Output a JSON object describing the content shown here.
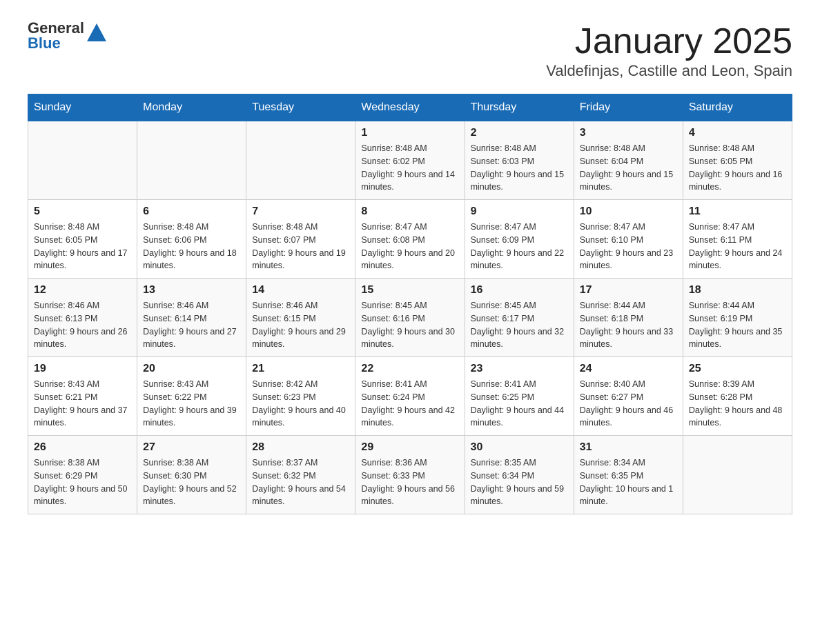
{
  "header": {
    "logo": {
      "general": "General",
      "blue": "Blue"
    },
    "title": "January 2025",
    "subtitle": "Valdefinjas, Castille and Leon, Spain"
  },
  "calendar": {
    "days_of_week": [
      "Sunday",
      "Monday",
      "Tuesday",
      "Wednesday",
      "Thursday",
      "Friday",
      "Saturday"
    ],
    "weeks": [
      [
        {
          "day": "",
          "info": ""
        },
        {
          "day": "",
          "info": ""
        },
        {
          "day": "",
          "info": ""
        },
        {
          "day": "1",
          "info": "Sunrise: 8:48 AM\nSunset: 6:02 PM\nDaylight: 9 hours and 14 minutes."
        },
        {
          "day": "2",
          "info": "Sunrise: 8:48 AM\nSunset: 6:03 PM\nDaylight: 9 hours and 15 minutes."
        },
        {
          "day": "3",
          "info": "Sunrise: 8:48 AM\nSunset: 6:04 PM\nDaylight: 9 hours and 15 minutes."
        },
        {
          "day": "4",
          "info": "Sunrise: 8:48 AM\nSunset: 6:05 PM\nDaylight: 9 hours and 16 minutes."
        }
      ],
      [
        {
          "day": "5",
          "info": "Sunrise: 8:48 AM\nSunset: 6:05 PM\nDaylight: 9 hours and 17 minutes."
        },
        {
          "day": "6",
          "info": "Sunrise: 8:48 AM\nSunset: 6:06 PM\nDaylight: 9 hours and 18 minutes."
        },
        {
          "day": "7",
          "info": "Sunrise: 8:48 AM\nSunset: 6:07 PM\nDaylight: 9 hours and 19 minutes."
        },
        {
          "day": "8",
          "info": "Sunrise: 8:47 AM\nSunset: 6:08 PM\nDaylight: 9 hours and 20 minutes."
        },
        {
          "day": "9",
          "info": "Sunrise: 8:47 AM\nSunset: 6:09 PM\nDaylight: 9 hours and 22 minutes."
        },
        {
          "day": "10",
          "info": "Sunrise: 8:47 AM\nSunset: 6:10 PM\nDaylight: 9 hours and 23 minutes."
        },
        {
          "day": "11",
          "info": "Sunrise: 8:47 AM\nSunset: 6:11 PM\nDaylight: 9 hours and 24 minutes."
        }
      ],
      [
        {
          "day": "12",
          "info": "Sunrise: 8:46 AM\nSunset: 6:13 PM\nDaylight: 9 hours and 26 minutes."
        },
        {
          "day": "13",
          "info": "Sunrise: 8:46 AM\nSunset: 6:14 PM\nDaylight: 9 hours and 27 minutes."
        },
        {
          "day": "14",
          "info": "Sunrise: 8:46 AM\nSunset: 6:15 PM\nDaylight: 9 hours and 29 minutes."
        },
        {
          "day": "15",
          "info": "Sunrise: 8:45 AM\nSunset: 6:16 PM\nDaylight: 9 hours and 30 minutes."
        },
        {
          "day": "16",
          "info": "Sunrise: 8:45 AM\nSunset: 6:17 PM\nDaylight: 9 hours and 32 minutes."
        },
        {
          "day": "17",
          "info": "Sunrise: 8:44 AM\nSunset: 6:18 PM\nDaylight: 9 hours and 33 minutes."
        },
        {
          "day": "18",
          "info": "Sunrise: 8:44 AM\nSunset: 6:19 PM\nDaylight: 9 hours and 35 minutes."
        }
      ],
      [
        {
          "day": "19",
          "info": "Sunrise: 8:43 AM\nSunset: 6:21 PM\nDaylight: 9 hours and 37 minutes."
        },
        {
          "day": "20",
          "info": "Sunrise: 8:43 AM\nSunset: 6:22 PM\nDaylight: 9 hours and 39 minutes."
        },
        {
          "day": "21",
          "info": "Sunrise: 8:42 AM\nSunset: 6:23 PM\nDaylight: 9 hours and 40 minutes."
        },
        {
          "day": "22",
          "info": "Sunrise: 8:41 AM\nSunset: 6:24 PM\nDaylight: 9 hours and 42 minutes."
        },
        {
          "day": "23",
          "info": "Sunrise: 8:41 AM\nSunset: 6:25 PM\nDaylight: 9 hours and 44 minutes."
        },
        {
          "day": "24",
          "info": "Sunrise: 8:40 AM\nSunset: 6:27 PM\nDaylight: 9 hours and 46 minutes."
        },
        {
          "day": "25",
          "info": "Sunrise: 8:39 AM\nSunset: 6:28 PM\nDaylight: 9 hours and 48 minutes."
        }
      ],
      [
        {
          "day": "26",
          "info": "Sunrise: 8:38 AM\nSunset: 6:29 PM\nDaylight: 9 hours and 50 minutes."
        },
        {
          "day": "27",
          "info": "Sunrise: 8:38 AM\nSunset: 6:30 PM\nDaylight: 9 hours and 52 minutes."
        },
        {
          "day": "28",
          "info": "Sunrise: 8:37 AM\nSunset: 6:32 PM\nDaylight: 9 hours and 54 minutes."
        },
        {
          "day": "29",
          "info": "Sunrise: 8:36 AM\nSunset: 6:33 PM\nDaylight: 9 hours and 56 minutes."
        },
        {
          "day": "30",
          "info": "Sunrise: 8:35 AM\nSunset: 6:34 PM\nDaylight: 9 hours and 59 minutes."
        },
        {
          "day": "31",
          "info": "Sunrise: 8:34 AM\nSunset: 6:35 PM\nDaylight: 10 hours and 1 minute."
        },
        {
          "day": "",
          "info": ""
        }
      ]
    ]
  }
}
